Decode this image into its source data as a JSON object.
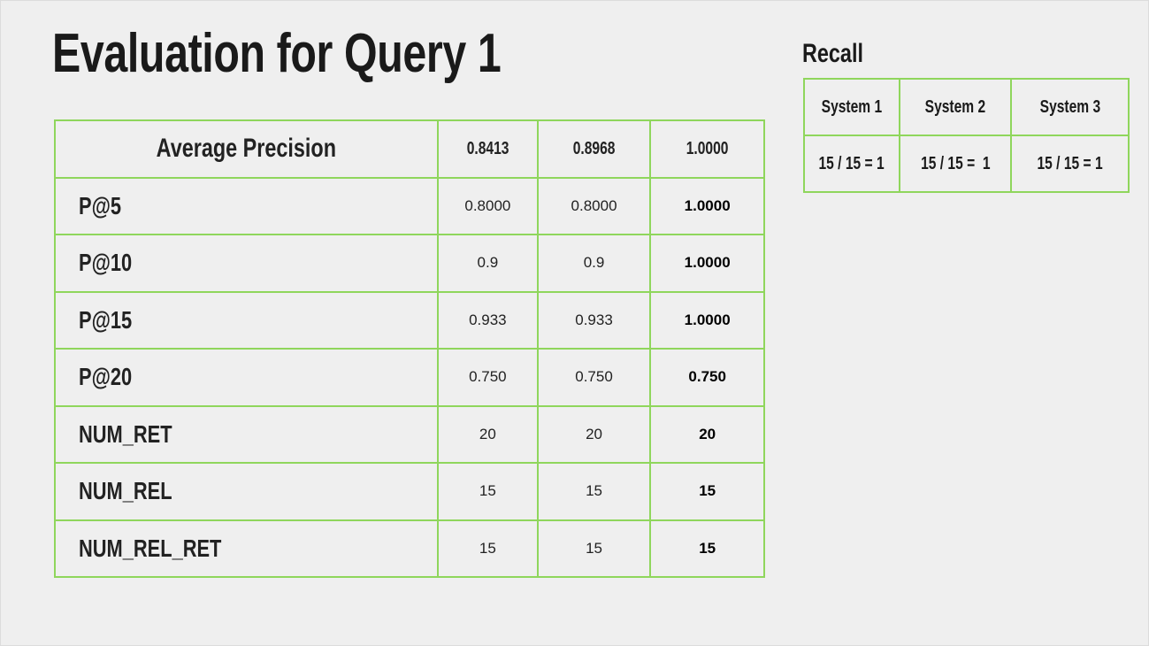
{
  "title": "Evaluation for Query 1",
  "colors": {
    "border": "#8fd65c",
    "background": "#efefef",
    "text": "#1a1a1a"
  },
  "main_table": {
    "header": {
      "label": "Average Precision",
      "values": [
        "0.8413",
        "0.8968",
        "1.0000"
      ]
    },
    "rows": [
      {
        "label": "P@5",
        "values": [
          "0.8000",
          "0.8000",
          "1.0000"
        ]
      },
      {
        "label": "P@10",
        "values": [
          "0.9",
          "0.9",
          "1.0000"
        ]
      },
      {
        "label": "P@15",
        "values": [
          "0.933",
          "0.933",
          "1.0000"
        ]
      },
      {
        "label": "P@20",
        "values": [
          "0.750",
          "0.750",
          "0.750"
        ]
      },
      {
        "label": "NUM_RET",
        "values": [
          "20",
          "20",
          "20"
        ]
      },
      {
        "label": "NUM_REL",
        "values": [
          "15",
          "15",
          "15"
        ]
      },
      {
        "label": "NUM_REL_RET",
        "values": [
          "15",
          "15",
          "15"
        ]
      }
    ]
  },
  "recall": {
    "title": "Recall",
    "headers": [
      "System 1",
      "System 2",
      "System 3"
    ],
    "values": [
      "15 / 15 = 1",
      "15 / 15 =  1",
      "15 / 15 = 1"
    ]
  }
}
